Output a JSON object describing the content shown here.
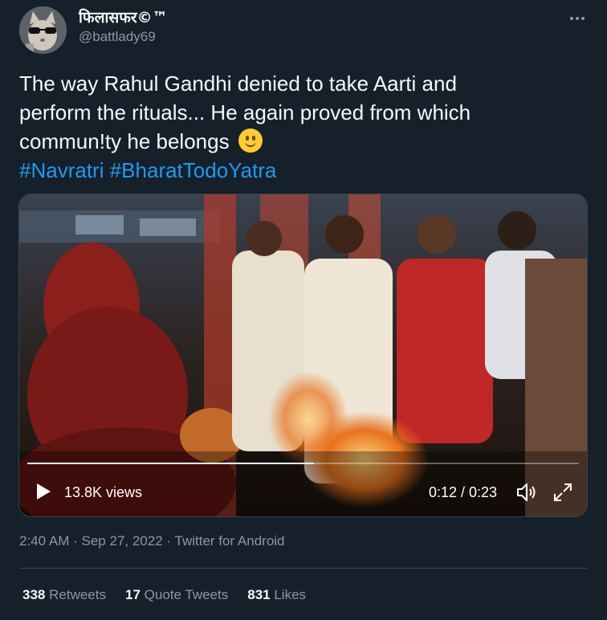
{
  "author": {
    "display_name": "फिलासफर©™",
    "handle": "@battlady69",
    "avatar_icon": "cat-with-sunglasses-avatar"
  },
  "tweet": {
    "text_line1": "The way Rahul Gandhi denied to take Aarti and",
    "text_line2": "perform the rituals... He again proved from which",
    "text_line3": "commun!ty he belongs",
    "emoji": "smiling-face-emoji",
    "hashtags": [
      "#Navratri",
      "#BharatTodoYatra"
    ]
  },
  "video": {
    "views": "13.8K views",
    "time": "0:12 / 0:23",
    "progress": 0.52
  },
  "meta": {
    "time": "2:40 AM",
    "separator": "·",
    "date": "Sep 27, 2022",
    "source": "Twitter for Android"
  },
  "stats": {
    "retweets_count": "338",
    "retweets_label": "Retweets",
    "quote_count": "17",
    "quote_label": "Quote Tweets",
    "likes_count": "831",
    "likes_label": "Likes"
  },
  "colors": {
    "background": "#15202b",
    "text": "#f7f9f9",
    "secondary": "#8b98a5",
    "link": "#1d9bf0",
    "border": "#38444d"
  }
}
